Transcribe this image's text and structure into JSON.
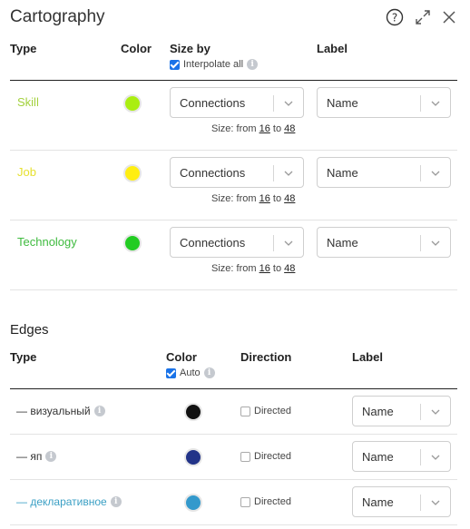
{
  "header": {
    "title": "Cartography",
    "icons": [
      "help-icon",
      "expand-icon",
      "close-icon"
    ]
  },
  "nodes": {
    "columns": {
      "type": "Type",
      "color": "Color",
      "size_by": "Size by",
      "label": "Label"
    },
    "interpolate_all": {
      "label": "Interpolate all",
      "checked": true
    },
    "rows": [
      {
        "name": "Skill",
        "text_color": "#a3d13d",
        "swatch": "#aaee11",
        "size_by": "Connections",
        "label": "Name",
        "size_prefix": "Size: from",
        "size_from": "16",
        "size_to_word": "to",
        "size_to": "48"
      },
      {
        "name": "Job",
        "text_color": "#e6e030",
        "swatch": "#ffee11",
        "size_by": "Connections",
        "label": "Name",
        "size_prefix": "Size: from",
        "size_from": "16",
        "size_to_word": "to",
        "size_to": "48"
      },
      {
        "name": "Technology",
        "text_color": "#3fbb3f",
        "swatch": "#22cc22",
        "size_by": "Connections",
        "label": "Name",
        "size_prefix": "Size: from",
        "size_from": "16",
        "size_to_word": "to",
        "size_to": "48"
      }
    ]
  },
  "edges": {
    "title": "Edges",
    "columns": {
      "type": "Type",
      "color": "Color",
      "direction": "Direction",
      "label": "Label"
    },
    "auto": {
      "label": "Auto",
      "checked": true
    },
    "rows": [
      {
        "name": "— визуальный",
        "text_color": "#333333",
        "swatch": "#111111",
        "directed_label": "Directed",
        "directed": false,
        "label": "Name"
      },
      {
        "name": "— яп",
        "text_color": "#333333",
        "swatch": "#223388",
        "directed_label": "Directed",
        "directed": false,
        "label": "Name"
      },
      {
        "name": "— декларативное",
        "text_color": "#3a9fc4",
        "swatch": "#3399cc",
        "directed_label": "Directed",
        "directed": false,
        "label": "Name"
      }
    ]
  }
}
